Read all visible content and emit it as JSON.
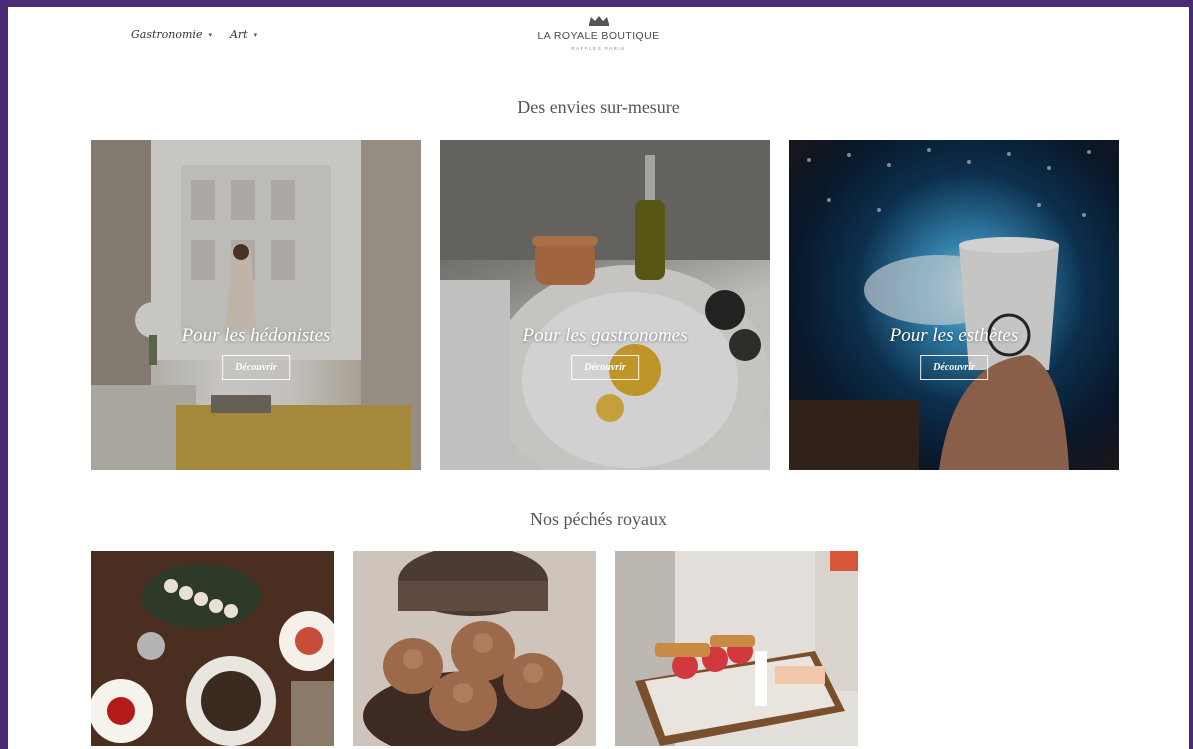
{
  "nav": {
    "items": [
      {
        "label": "Gastronomie",
        "caret": "▾"
      },
      {
        "label": "Art",
        "caret": "▾"
      }
    ]
  },
  "brand": {
    "name": "LA ROYALE BOUTIQUE",
    "sub": "RAFFLES PARIS"
  },
  "sections": {
    "envies_title": "Des envies sur-mesure",
    "peches_title": "Nos péchés royaux"
  },
  "cards": [
    {
      "title": "Pour les hédonistes",
      "button": "Découvrir"
    },
    {
      "title": "Pour les gastronomes",
      "button": "Découvrir"
    },
    {
      "title": "Pour les esthètes",
      "button": "Découvrir"
    }
  ],
  "colors": {
    "frame": "#4b2a78",
    "background": "#ffffff",
    "text": "#555555"
  }
}
